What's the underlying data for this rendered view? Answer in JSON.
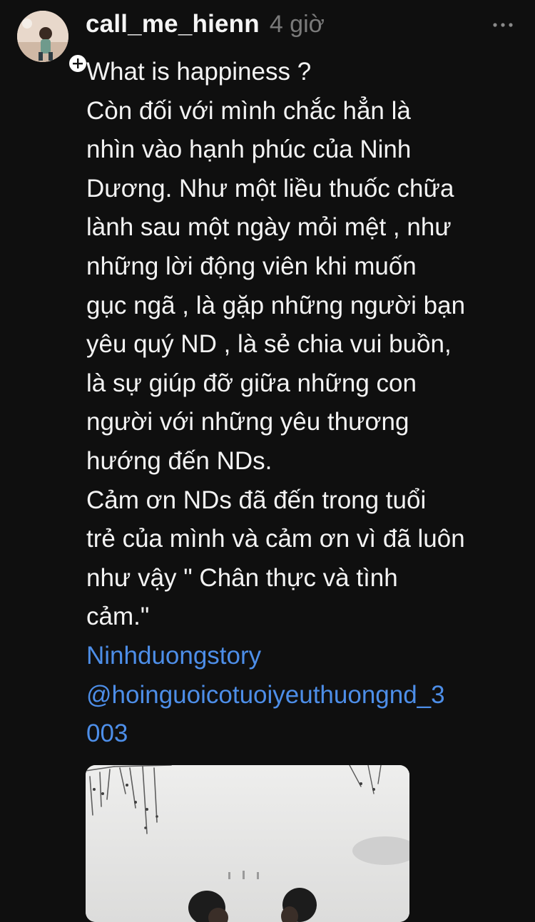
{
  "post": {
    "author": {
      "username": "call_me_hienn",
      "avatar": "avatar",
      "follow_icon": "plus-icon"
    },
    "timestamp": "4 giờ",
    "more_icon": "more-icon",
    "body_lines": [
      "What is happiness ?",
      "Còn đối với mình chắc hẳn là",
      "nhìn vào hạnh phúc của Ninh",
      "Dương. Như một liều thuốc chữa",
      "lành sau một ngày mỏi mệt , như",
      "những lời động viên khi muốn",
      "gục ngã , là gặp những người bạn",
      "yêu quý ND , là sẻ chia vui buồn,",
      "là sự giúp đỡ giữa những con",
      "người với những yêu thương",
      "hướng đến NDs.",
      "Cảm ơn NDs đã đến trong tuổi",
      "trẻ của mình và cảm ơn vì đã luôn",
      "như vậy \" Chân thực và tình",
      "cảm.\""
    ],
    "tag_lines": [
      "Ninhduongstory",
      "@hoinguoicotuoiyeuthuongnd_3",
      "003"
    ]
  },
  "colors": {
    "background": "#0f0f0f",
    "text": "#f3f3f3",
    "muted": "#7a7a7a",
    "link": "#4d8ee8"
  }
}
